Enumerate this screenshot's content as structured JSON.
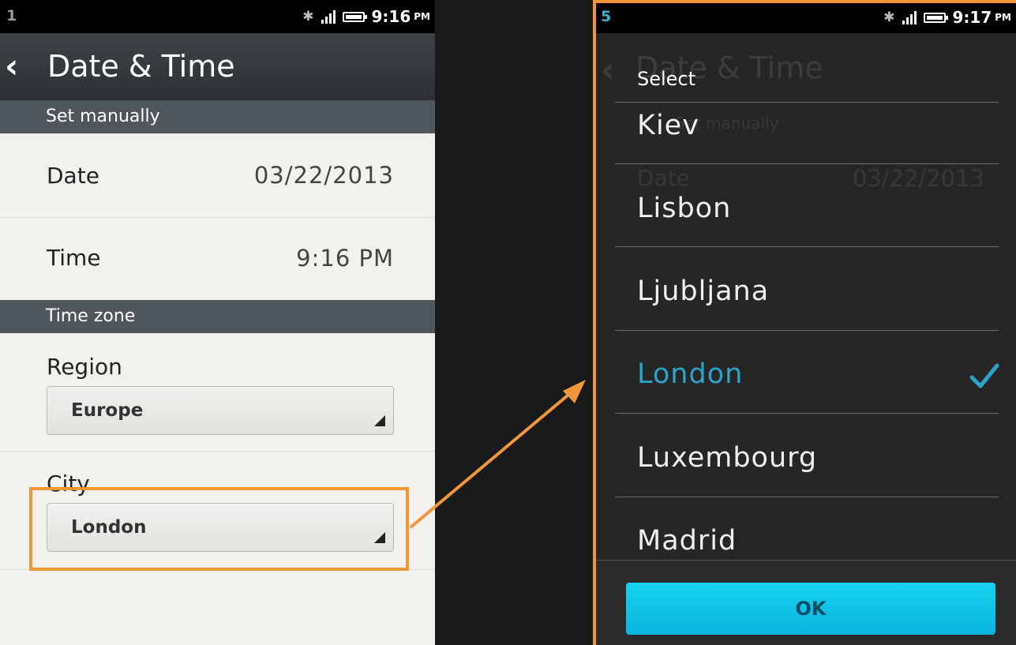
{
  "left": {
    "status": {
      "notification_count": "1",
      "time": "9:16",
      "ampm": "PM"
    },
    "title": "Date & Time",
    "sections": {
      "manual": "Set manually",
      "timezone": "Time zone"
    },
    "date": {
      "label": "Date",
      "value": "03/22/2013"
    },
    "time": {
      "label": "Time",
      "value": "9:16 PM"
    },
    "region": {
      "label": "Region",
      "value": "Europe"
    },
    "city": {
      "label": "City",
      "value": "London"
    }
  },
  "right": {
    "status": {
      "notification_count": "5",
      "time": "9:17",
      "ampm": "PM"
    },
    "background": {
      "title": "Date & Time",
      "section": "Set manually",
      "date_label": "Date",
      "date_value": "03/22/2013"
    },
    "dialog_title": "Select",
    "options": [
      {
        "label": "Kiev",
        "selected": false
      },
      {
        "label": "Lisbon",
        "selected": false
      },
      {
        "label": "Ljubljana",
        "selected": false
      },
      {
        "label": "London",
        "selected": true
      },
      {
        "label": "Luxembourg",
        "selected": false
      },
      {
        "label": "Madrid",
        "selected": false
      }
    ],
    "ok_label": "OK"
  },
  "colors": {
    "highlight": "#f1973a",
    "accent": "#2aa4c9",
    "ok_button": "#10c4e6"
  },
  "icons": [
    "back-arrow-icon",
    "bluetooth-icon",
    "signal-icon",
    "battery-icon",
    "dropdown-triangle-icon",
    "check-icon"
  ]
}
